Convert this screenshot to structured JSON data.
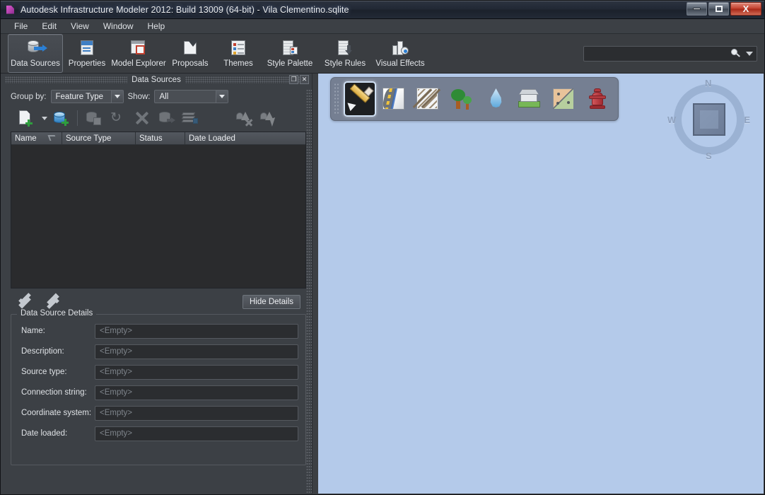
{
  "window": {
    "title": "Autodesk Infrastructure Modeler 2012: Build 13009 (64-bit) - Vila Clementino.sqlite",
    "app_icon": "autodesk-app-icon",
    "controls": {
      "minimize": "minimize-button",
      "maximize": "maximize-button",
      "close_label": "X"
    }
  },
  "menubar": {
    "items": [
      {
        "label": "File"
      },
      {
        "label": "Edit"
      },
      {
        "label": "View"
      },
      {
        "label": "Window"
      },
      {
        "label": "Help"
      }
    ]
  },
  "ribbon": {
    "tabs": [
      {
        "label": "Data Sources",
        "icon": "database-arrow-icon",
        "active": true
      },
      {
        "label": "Properties",
        "icon": "properties-window-icon",
        "active": false
      },
      {
        "label": "Model Explorer",
        "icon": "model-explorer-icon",
        "active": false
      },
      {
        "label": "Proposals",
        "icon": "proposals-icon",
        "active": false
      },
      {
        "label": "Themes",
        "icon": "themes-list-icon",
        "active": false
      },
      {
        "label": "Style Palette",
        "icon": "style-palette-icon",
        "active": false
      },
      {
        "label": "Style Rules",
        "icon": "style-rules-icon",
        "active": false
      },
      {
        "label": "Visual Effects",
        "icon": "visual-effects-icon",
        "active": false
      }
    ],
    "search": {
      "value": "",
      "placeholder": "",
      "icon": "search-icon",
      "dropdown_icon": "chevron-down-icon"
    }
  },
  "panel": {
    "title": "Data Sources",
    "titlebar_buttons": {
      "float": "❐",
      "close": "✕"
    },
    "filters": {
      "group_by_label": "Group by:",
      "group_by_value": "Feature Type",
      "show_label": "Show:",
      "show_value": "All"
    },
    "toolbar": [
      {
        "name": "new-data-source-button",
        "icon": "new-file-plus-icon",
        "enabled": true
      },
      {
        "name": "new-data-source-dropdown",
        "icon": "caret-down-icon",
        "enabled": true
      },
      {
        "name": "add-database-button",
        "icon": "database-plus-icon",
        "enabled": true
      },
      {
        "name": "connect-data-source-button",
        "icon": "database-connect-icon",
        "enabled": false
      },
      {
        "name": "refresh-button",
        "icon": "refresh-icon",
        "enabled": false
      },
      {
        "name": "remove-data-source-button",
        "icon": "close-x-icon",
        "enabled": false
      },
      {
        "name": "save-data-source-button",
        "icon": "database-save-icon",
        "enabled": false
      },
      {
        "name": "layers-button",
        "icon": "layers-icon",
        "enabled": false
      },
      {
        "name": "clear-selection-button",
        "icon": "selection-clear-icon",
        "enabled": false
      },
      {
        "name": "select-features-button",
        "icon": "selection-pointer-icon",
        "enabled": false
      }
    ],
    "table": {
      "columns": [
        {
          "label": "Name",
          "sorted": true
        },
        {
          "label": "Source Type",
          "sorted": false
        },
        {
          "label": "Status",
          "sorted": false
        },
        {
          "label": "Date Loaded",
          "sorted": false
        }
      ],
      "rows": []
    },
    "details_controls": {
      "expand_all_icon": "double-chevron-down-icon",
      "collapse_all_icon": "double-chevron-up-icon",
      "hide_details_label": "Hide Details"
    },
    "details": {
      "legend": "Data Source Details",
      "fields": [
        {
          "label": "Name:",
          "value": "<Empty>"
        },
        {
          "label": "Description:",
          "value": "<Empty>"
        },
        {
          "label": "Source type:",
          "value": "<Empty>"
        },
        {
          "label": "Connection string:",
          "value": "<Empty>"
        },
        {
          "label": "Coordinate system:",
          "value": "<Empty>"
        },
        {
          "label": "Date loaded:",
          "value": "<Empty>"
        }
      ]
    }
  },
  "canvas": {
    "background_color": "#b4caea",
    "float_toolbar": [
      {
        "name": "draw-pencil-tool",
        "icon": "pencil-icon",
        "active": true
      },
      {
        "name": "road-tool",
        "icon": "road-icon",
        "active": false
      },
      {
        "name": "railway-tool",
        "icon": "railway-icon",
        "active": false
      },
      {
        "name": "vegetation-tool",
        "icon": "trees-icon",
        "active": false
      },
      {
        "name": "water-tool",
        "icon": "water-drop-icon",
        "active": false
      },
      {
        "name": "building-tool",
        "icon": "building-icon",
        "active": false
      },
      {
        "name": "parcel-tool",
        "icon": "parcel-map-icon",
        "active": false
      },
      {
        "name": "utility-tool",
        "icon": "fire-hydrant-icon",
        "active": false
      }
    ],
    "viewcube": {
      "north": "N",
      "south": "S",
      "east": "E",
      "west": "W"
    }
  }
}
